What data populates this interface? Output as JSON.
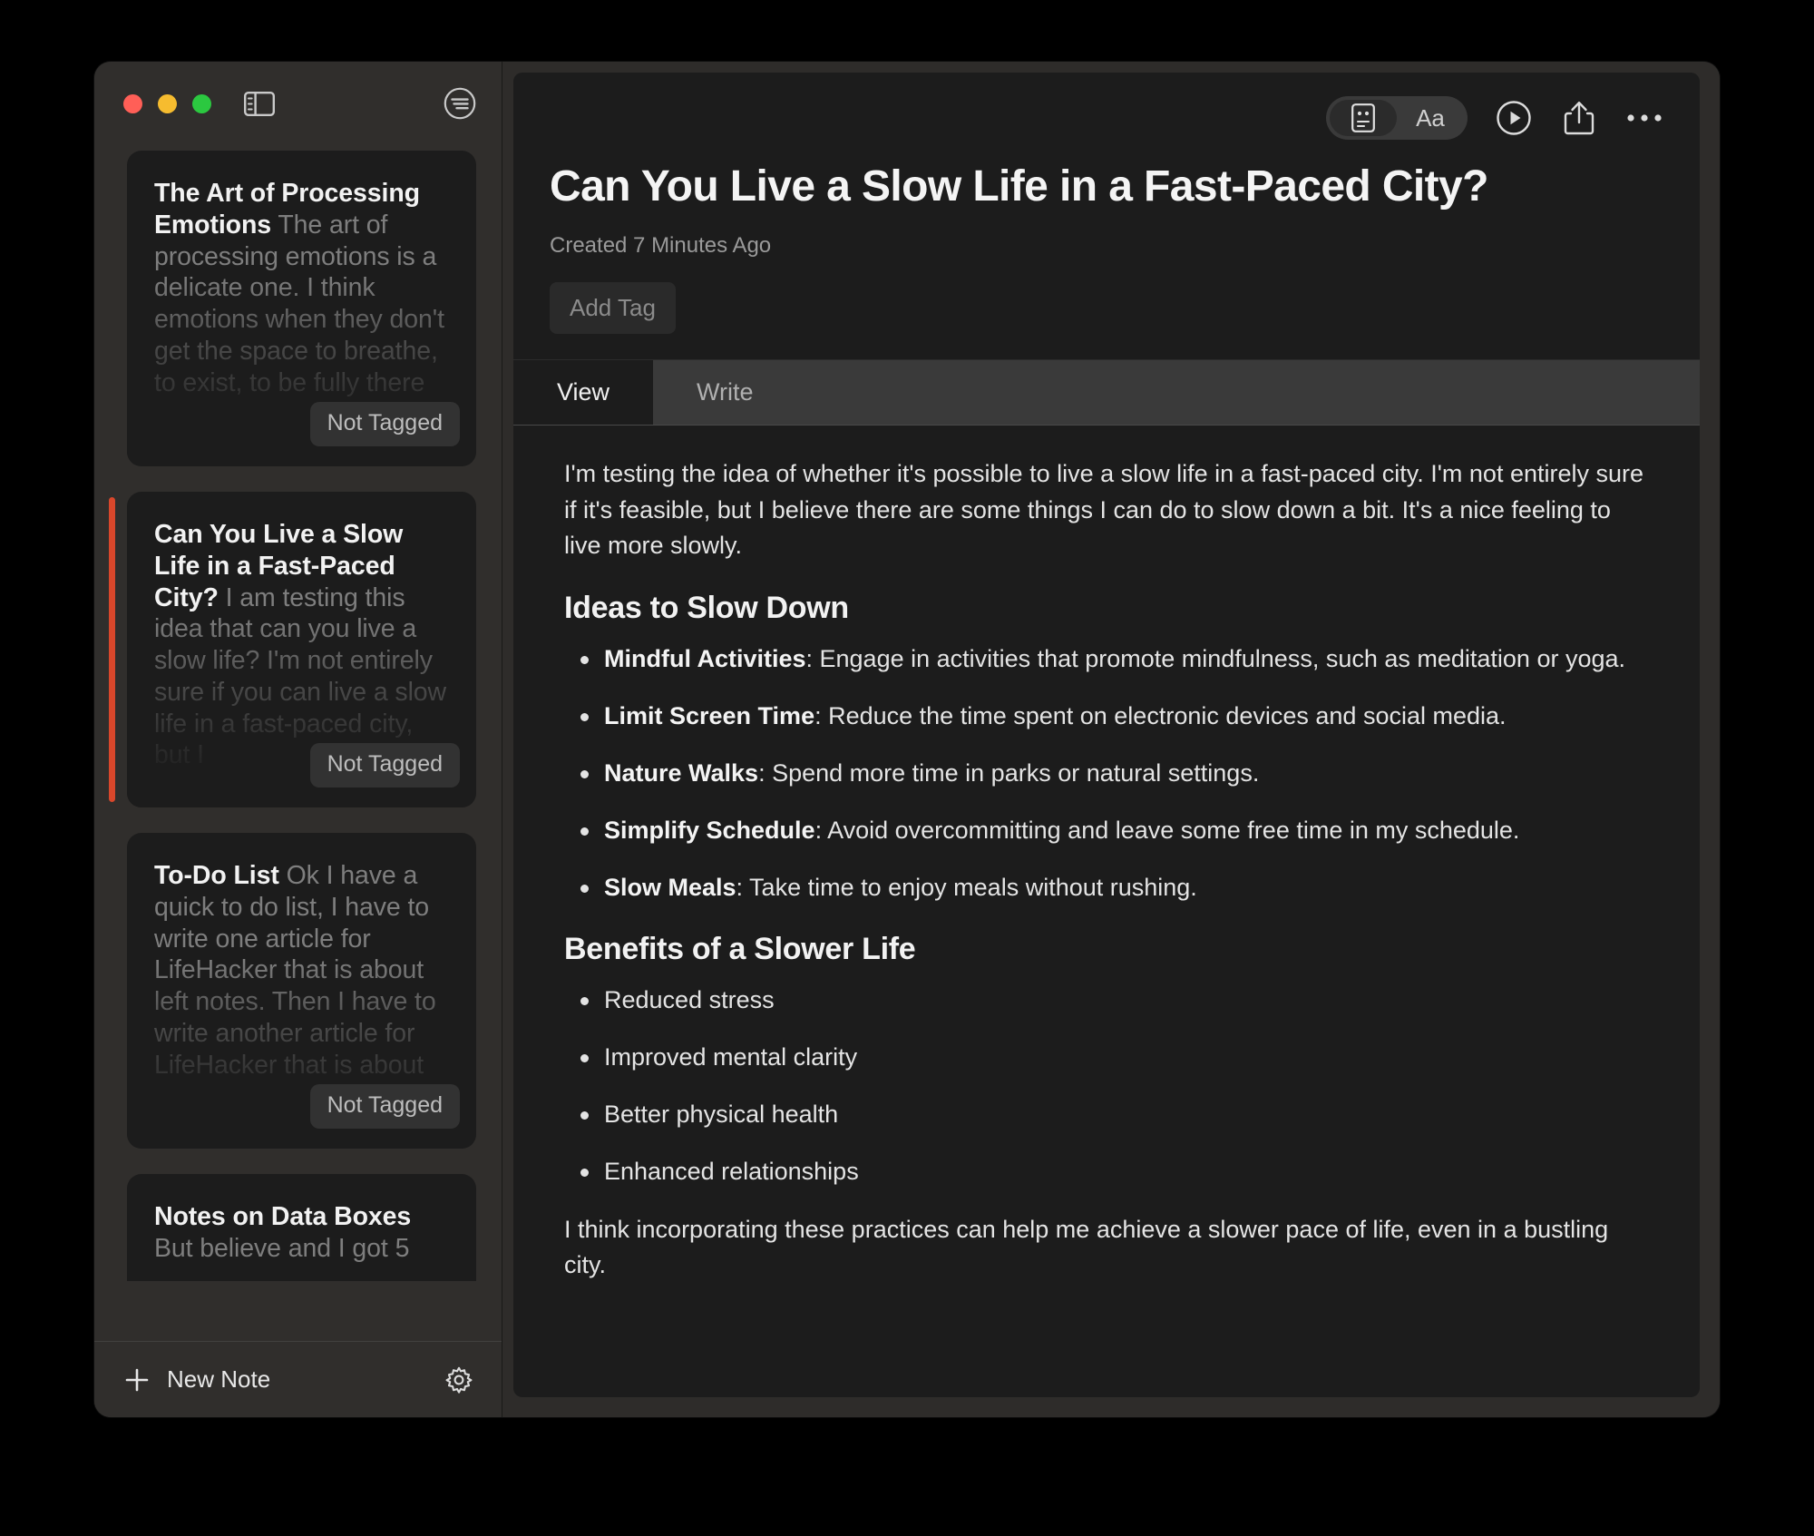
{
  "window": {
    "traffic_lights": {
      "close": "close-window",
      "minimize": "minimize-window",
      "maximize": "maximize-window"
    }
  },
  "sidebar": {
    "toolbar": {
      "sidebar_toggle_icon": "sidebar-toggle-icon",
      "sort_icon": "sort-filter-icon"
    },
    "notes": [
      {
        "title": "The Art of Processing Emotions",
        "preview": "The art of processing emotions is a delicate one. I think emotions when they don't get the space to breathe, to exist, to be fully there",
        "tag": "Not Tagged",
        "selected": false
      },
      {
        "title": "Can You Live a Slow Life in a Fast-Paced City?",
        "preview": "I am testing this idea that can you live a slow life? I'm not entirely sure if you can live a slow life in a fast-paced city, but I",
        "tag": "Not Tagged",
        "selected": true
      },
      {
        "title": "To-Do List",
        "preview": "Ok I have a quick to do list, I have to write one article for LifeHacker that is about left notes. Then I have to write another article for LifeHacker that is about",
        "tag": "Not Tagged",
        "selected": false
      },
      {
        "title": "Notes on Data Boxes",
        "preview": "But believe and I got 5",
        "tag": "",
        "selected": false
      }
    ],
    "footer": {
      "new_note_label": "New Note",
      "new_note_icon": "plus-icon",
      "settings_icon": "gear-icon"
    }
  },
  "main": {
    "toolbar": {
      "segmented": [
        {
          "label": "",
          "icon": "note-card-icon",
          "active": true
        },
        {
          "label": "Aa",
          "icon": "",
          "active": false
        }
      ],
      "play_icon": "play-circle-icon",
      "share_icon": "share-upload-icon",
      "more_icon": "more-horizontal-icon"
    },
    "note": {
      "title": "Can You Live a Slow Life in a Fast-Paced City?",
      "created": "Created 7 Minutes Ago",
      "add_tag_label": "Add Tag"
    },
    "tabs": [
      {
        "label": "View",
        "active": true
      },
      {
        "label": "Write",
        "active": false
      }
    ],
    "body": {
      "intro": "I'm testing the idea of whether it's possible to live a slow life in a fast-paced city. I'm not entirely sure if it's feasible, but I believe there are some things I can do to slow down a bit. It's a nice feeling to live more slowly.",
      "heading1": "Ideas to Slow Down",
      "ideas": [
        {
          "term": "Mindful Activities",
          "desc": ": Engage in activities that promote mindfulness, such as meditation or yoga."
        },
        {
          "term": "Limit Screen Time",
          "desc": ": Reduce the time spent on electronic devices and social media."
        },
        {
          "term": "Nature Walks",
          "desc": ": Spend more time in parks or natural settings."
        },
        {
          "term": "Simplify Schedule",
          "desc": ": Avoid overcommitting and leave some free time in my schedule."
        },
        {
          "term": "Slow Meals",
          "desc": ": Take time to enjoy meals without rushing."
        }
      ],
      "heading2": "Benefits of a Slower Life",
      "benefits": [
        "Reduced stress",
        "Improved mental clarity",
        "Better physical health",
        "Enhanced relationships"
      ],
      "closing": "I think incorporating these practices can help me achieve a slower pace of life, even in a bustling city."
    }
  },
  "colors": {
    "selection_accent": "#d9472b",
    "window_chrome": "#302e2c",
    "panel_bg": "#1c1c1c",
    "traffic_close": "#ff5f57",
    "traffic_min": "#f6bc2f",
    "traffic_max": "#2bc840"
  }
}
